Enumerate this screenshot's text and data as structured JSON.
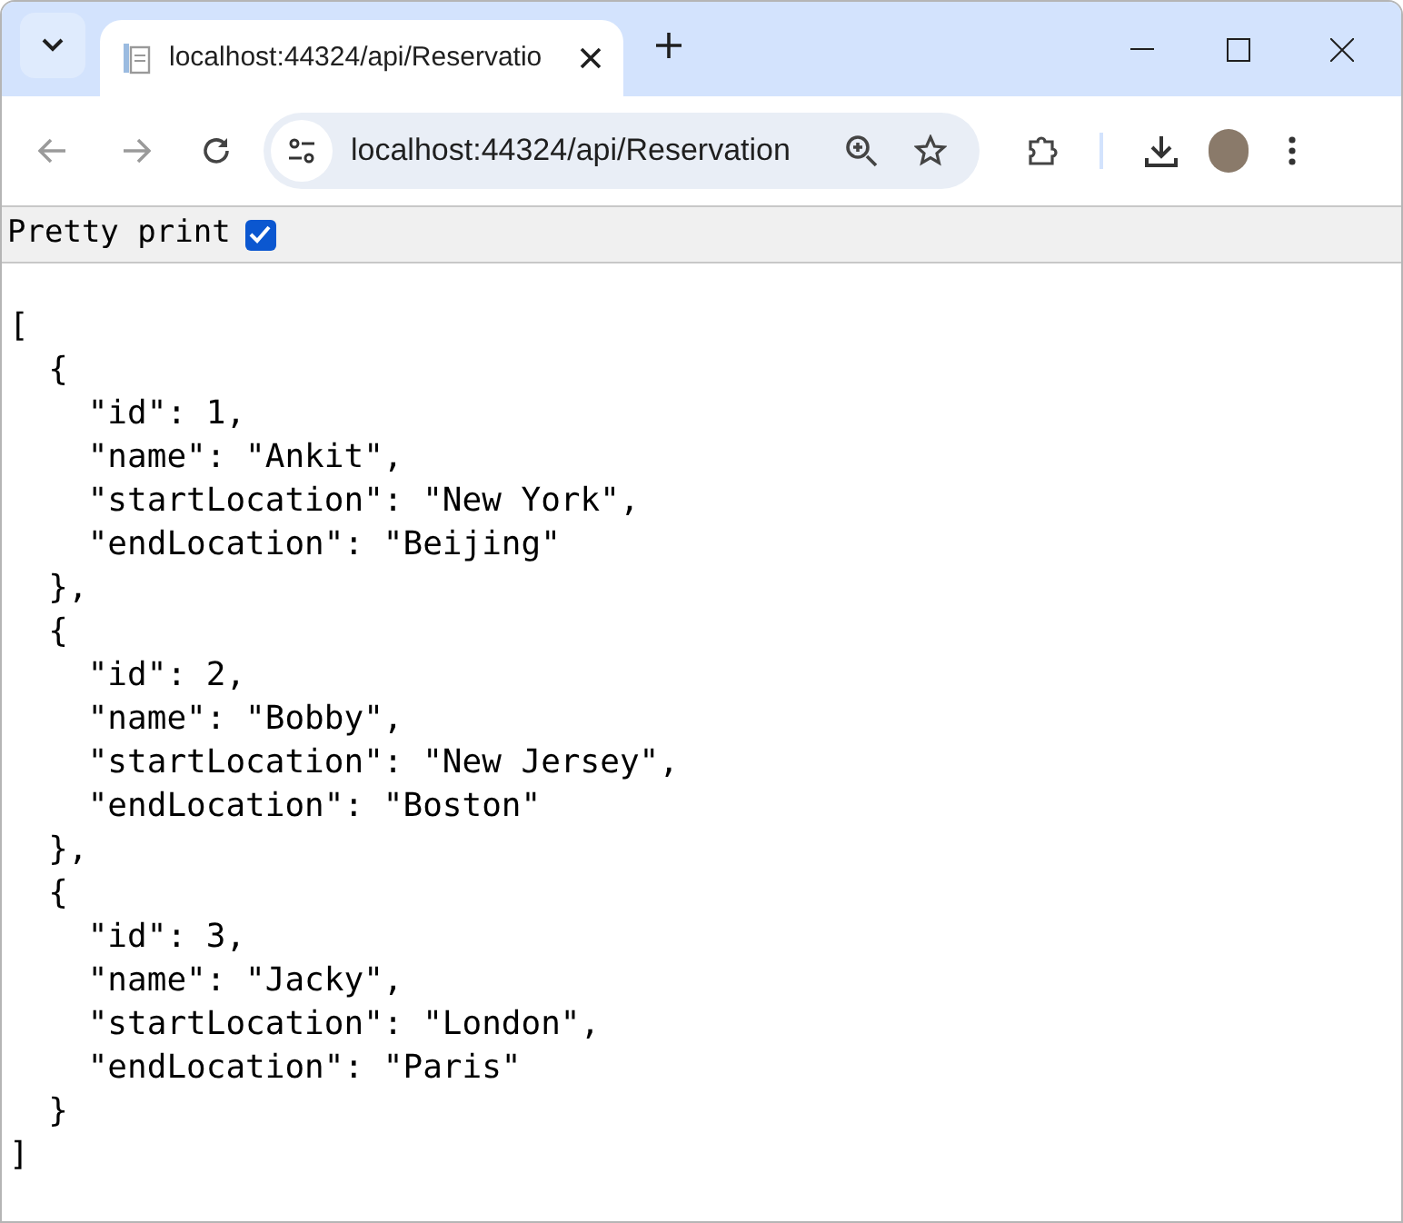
{
  "tab": {
    "title": "localhost:44324/api/Reservatio",
    "selected": true
  },
  "address_bar": {
    "url": "localhost:44324/api/Reservation"
  },
  "pretty_print": {
    "label": "Pretty print",
    "checked": true
  },
  "json_lines": [
    "[",
    "  {",
    "    \"id\": 1,",
    "    \"name\": \"Ankit\",",
    "    \"startLocation\": \"New York\",",
    "    \"endLocation\": \"Beijing\"",
    "  },",
    "  {",
    "    \"id\": 2,",
    "    \"name\": \"Bobby\",",
    "    \"startLocation\": \"New Jersey\",",
    "    \"endLocation\": \"Boston\"",
    "  },",
    "  {",
    "    \"id\": 3,",
    "    \"name\": \"Jacky\",",
    "    \"startLocation\": \"London\",",
    "    \"endLocation\": \"Paris\"",
    "  }",
    "]"
  ]
}
